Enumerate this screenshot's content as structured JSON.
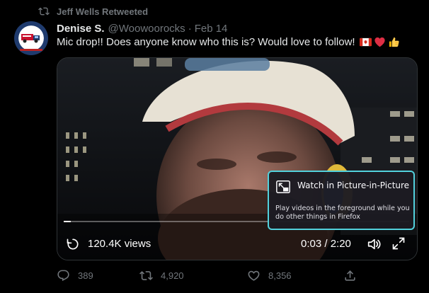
{
  "retweet": {
    "label": "Jeff Wells Retweeted",
    "icon": "retweet-icon"
  },
  "tweet": {
    "author_name": "Denise S.",
    "author_handle": "@Woowoorocks",
    "separator": "·",
    "date": "Feb 14",
    "text": "Mic drop!! Does anyone know who this is? Would love to follow!",
    "emojis": [
      "canada-flag-icon",
      "red-heart-icon",
      "thumbs-up-icon"
    ]
  },
  "video": {
    "views": "120.4K views",
    "time": "0:03 / 2:20",
    "progress_fraction": 0.02
  },
  "pip_tooltip": {
    "title": "Watch in Picture-in-Picture",
    "description": "Play videos in the foreground while you do other things in Firefox"
  },
  "actions": {
    "reply_count": "389",
    "retweet_count": "4,920",
    "like_count": "8,356"
  },
  "colors": {
    "background": "#000000",
    "muted_text": "#71767b",
    "pip_border": "#52d1dc",
    "heart": "#f91880"
  }
}
